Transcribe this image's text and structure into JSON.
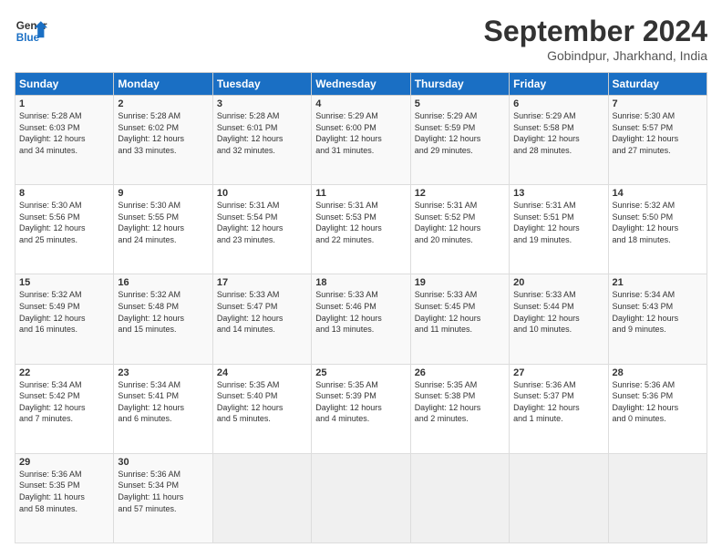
{
  "header": {
    "logo_line1": "General",
    "logo_line2": "Blue",
    "month_title": "September 2024",
    "location": "Gobindpur, Jharkhand, India"
  },
  "weekdays": [
    "Sunday",
    "Monday",
    "Tuesday",
    "Wednesday",
    "Thursday",
    "Friday",
    "Saturday"
  ],
  "weeks": [
    [
      {
        "day": "1",
        "info": "Sunrise: 5:28 AM\nSunset: 6:03 PM\nDaylight: 12 hours\nand 34 minutes."
      },
      {
        "day": "2",
        "info": "Sunrise: 5:28 AM\nSunset: 6:02 PM\nDaylight: 12 hours\nand 33 minutes."
      },
      {
        "day": "3",
        "info": "Sunrise: 5:28 AM\nSunset: 6:01 PM\nDaylight: 12 hours\nand 32 minutes."
      },
      {
        "day": "4",
        "info": "Sunrise: 5:29 AM\nSunset: 6:00 PM\nDaylight: 12 hours\nand 31 minutes."
      },
      {
        "day": "5",
        "info": "Sunrise: 5:29 AM\nSunset: 5:59 PM\nDaylight: 12 hours\nand 29 minutes."
      },
      {
        "day": "6",
        "info": "Sunrise: 5:29 AM\nSunset: 5:58 PM\nDaylight: 12 hours\nand 28 minutes."
      },
      {
        "day": "7",
        "info": "Sunrise: 5:30 AM\nSunset: 5:57 PM\nDaylight: 12 hours\nand 27 minutes."
      }
    ],
    [
      {
        "day": "8",
        "info": "Sunrise: 5:30 AM\nSunset: 5:56 PM\nDaylight: 12 hours\nand 25 minutes."
      },
      {
        "day": "9",
        "info": "Sunrise: 5:30 AM\nSunset: 5:55 PM\nDaylight: 12 hours\nand 24 minutes."
      },
      {
        "day": "10",
        "info": "Sunrise: 5:31 AM\nSunset: 5:54 PM\nDaylight: 12 hours\nand 23 minutes."
      },
      {
        "day": "11",
        "info": "Sunrise: 5:31 AM\nSunset: 5:53 PM\nDaylight: 12 hours\nand 22 minutes."
      },
      {
        "day": "12",
        "info": "Sunrise: 5:31 AM\nSunset: 5:52 PM\nDaylight: 12 hours\nand 20 minutes."
      },
      {
        "day": "13",
        "info": "Sunrise: 5:31 AM\nSunset: 5:51 PM\nDaylight: 12 hours\nand 19 minutes."
      },
      {
        "day": "14",
        "info": "Sunrise: 5:32 AM\nSunset: 5:50 PM\nDaylight: 12 hours\nand 18 minutes."
      }
    ],
    [
      {
        "day": "15",
        "info": "Sunrise: 5:32 AM\nSunset: 5:49 PM\nDaylight: 12 hours\nand 16 minutes."
      },
      {
        "day": "16",
        "info": "Sunrise: 5:32 AM\nSunset: 5:48 PM\nDaylight: 12 hours\nand 15 minutes."
      },
      {
        "day": "17",
        "info": "Sunrise: 5:33 AM\nSunset: 5:47 PM\nDaylight: 12 hours\nand 14 minutes."
      },
      {
        "day": "18",
        "info": "Sunrise: 5:33 AM\nSunset: 5:46 PM\nDaylight: 12 hours\nand 13 minutes."
      },
      {
        "day": "19",
        "info": "Sunrise: 5:33 AM\nSunset: 5:45 PM\nDaylight: 12 hours\nand 11 minutes."
      },
      {
        "day": "20",
        "info": "Sunrise: 5:33 AM\nSunset: 5:44 PM\nDaylight: 12 hours\nand 10 minutes."
      },
      {
        "day": "21",
        "info": "Sunrise: 5:34 AM\nSunset: 5:43 PM\nDaylight: 12 hours\nand 9 minutes."
      }
    ],
    [
      {
        "day": "22",
        "info": "Sunrise: 5:34 AM\nSunset: 5:42 PM\nDaylight: 12 hours\nand 7 minutes."
      },
      {
        "day": "23",
        "info": "Sunrise: 5:34 AM\nSunset: 5:41 PM\nDaylight: 12 hours\nand 6 minutes."
      },
      {
        "day": "24",
        "info": "Sunrise: 5:35 AM\nSunset: 5:40 PM\nDaylight: 12 hours\nand 5 minutes."
      },
      {
        "day": "25",
        "info": "Sunrise: 5:35 AM\nSunset: 5:39 PM\nDaylight: 12 hours\nand 4 minutes."
      },
      {
        "day": "26",
        "info": "Sunrise: 5:35 AM\nSunset: 5:38 PM\nDaylight: 12 hours\nand 2 minutes."
      },
      {
        "day": "27",
        "info": "Sunrise: 5:36 AM\nSunset: 5:37 PM\nDaylight: 12 hours\nand 1 minute."
      },
      {
        "day": "28",
        "info": "Sunrise: 5:36 AM\nSunset: 5:36 PM\nDaylight: 12 hours\nand 0 minutes."
      }
    ],
    [
      {
        "day": "29",
        "info": "Sunrise: 5:36 AM\nSunset: 5:35 PM\nDaylight: 11 hours\nand 58 minutes."
      },
      {
        "day": "30",
        "info": "Sunrise: 5:36 AM\nSunset: 5:34 PM\nDaylight: 11 hours\nand 57 minutes."
      },
      {
        "day": "",
        "info": ""
      },
      {
        "day": "",
        "info": ""
      },
      {
        "day": "",
        "info": ""
      },
      {
        "day": "",
        "info": ""
      },
      {
        "day": "",
        "info": ""
      }
    ]
  ]
}
